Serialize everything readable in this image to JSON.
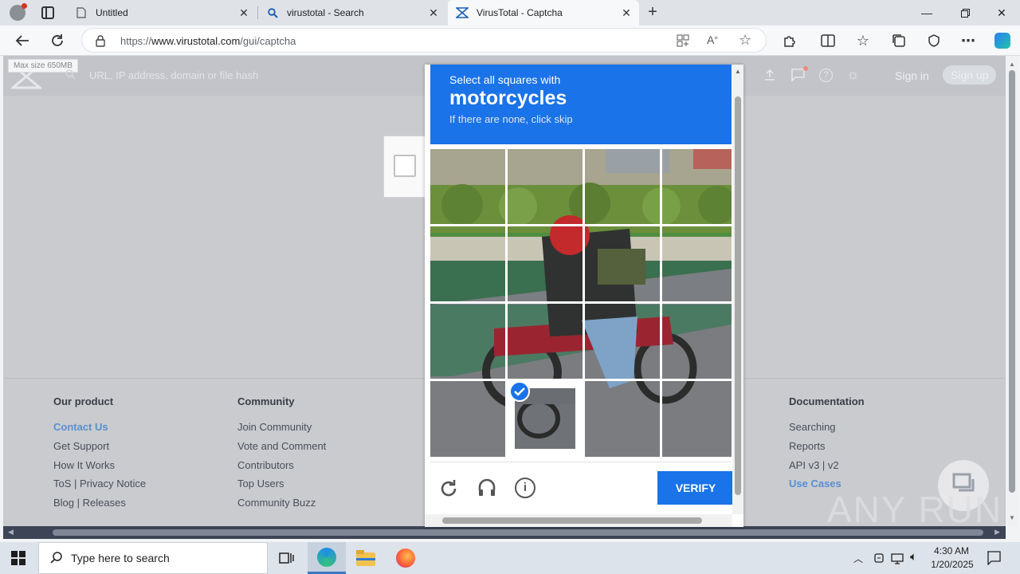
{
  "browser": {
    "tabs": [
      {
        "title": "Untitled",
        "icon": "page-icon",
        "active": false
      },
      {
        "title": "virustotal - Search",
        "icon": "search-icon",
        "active": false
      },
      {
        "title": "VirusTotal - Captcha",
        "icon": "virustotal-icon",
        "active": true
      }
    ],
    "url_prefix": "https://",
    "url_host": "www.virustotal.com",
    "url_path": "/gui/captcha"
  },
  "virustotal": {
    "tooltip": "Max size 650MB",
    "search_placeholder": "URL, IP address, domain or file hash",
    "sign_in": "Sign in",
    "sign_up": "Sign up"
  },
  "footer": {
    "columns": [
      {
        "title": "Our product",
        "links": [
          "Contact Us",
          "Get Support",
          "How It Works",
          "ToS | Privacy Notice",
          "Blog | Releases"
        ]
      },
      {
        "title": "Community",
        "links": [
          "Join Community",
          "Vote and Comment",
          "Contributors",
          "Top Users",
          "Community Buzz"
        ]
      },
      {
        "title": "Documentation",
        "links": [
          "Searching",
          "Reports",
          "API v3 | v2",
          "Use Cases"
        ]
      }
    ]
  },
  "captcha": {
    "instruction": "Select all squares with",
    "target": "motorcycles",
    "hint": "If there are none, click skip",
    "verify_label": "VERIFY",
    "selected_tile": "row 4, column 2"
  },
  "watermark": "ANY RUN",
  "taskbar": {
    "search_placeholder": "Type here to search",
    "time": "4:30 AM",
    "date": "1/20/2025"
  },
  "colors": {
    "captcha_blue": "#1a73e8",
    "link_highlight": "#5a8fd0"
  }
}
